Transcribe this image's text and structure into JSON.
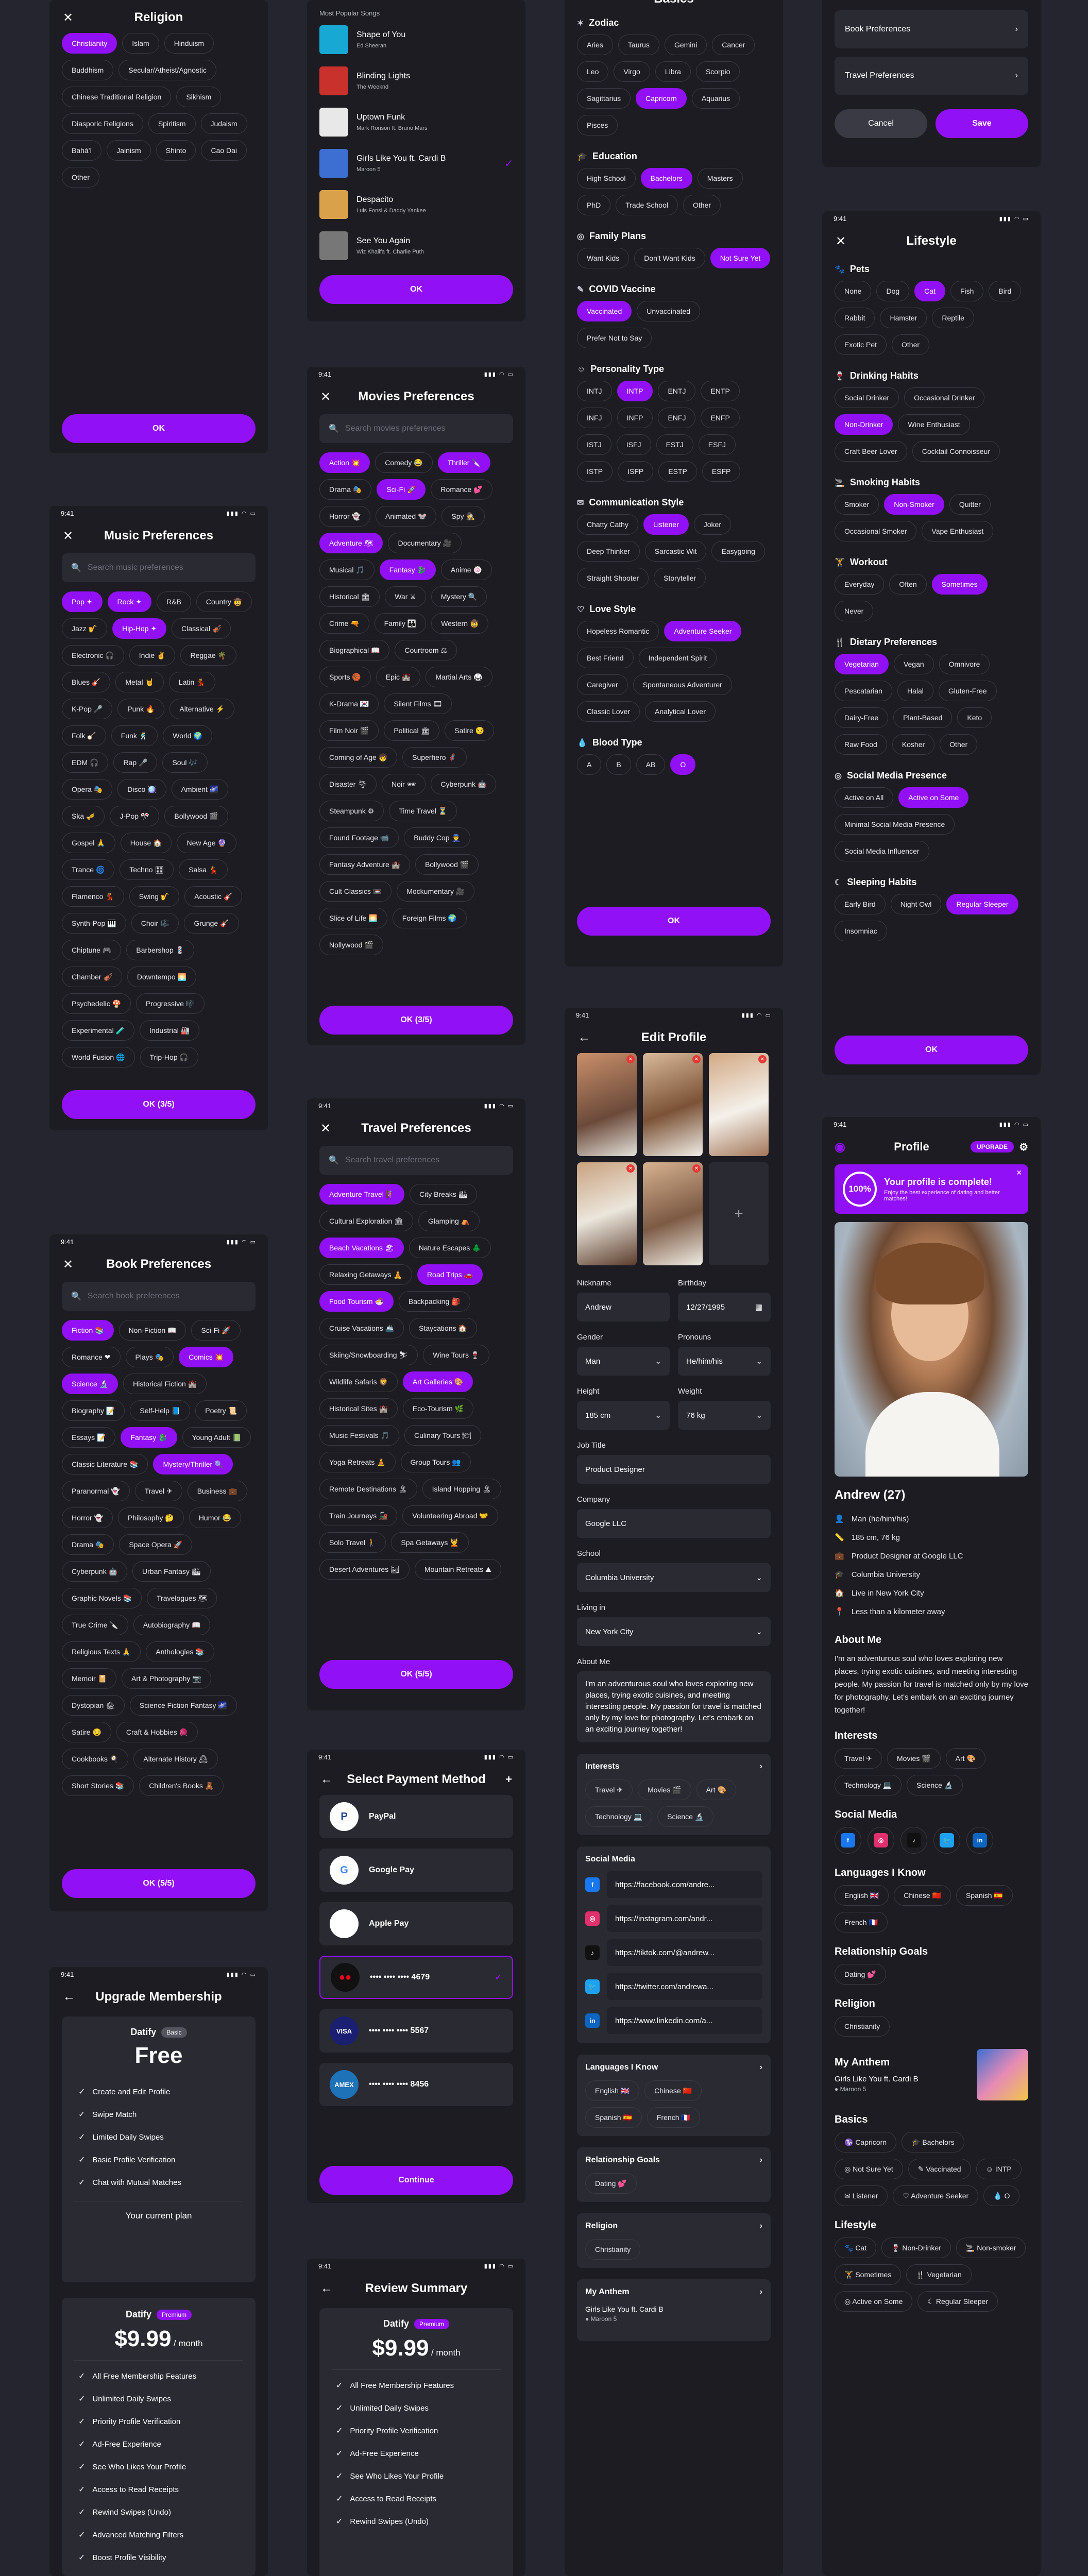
{
  "status_time": "9:41",
  "religion": {
    "title": "Religion",
    "close": "✕",
    "ok": "OK",
    "items": [
      "Christianity",
      "Islam",
      "Hinduism",
      "Buddhism",
      "Secular/Atheist/Agnostic",
      "Chinese Traditional Religion",
      "Sikhism",
      "Diasporic Religions",
      "Spiritism",
      "Judaism",
      "Bahá'í",
      "Jainism",
      "Shinto",
      "Cao Dai",
      "Other"
    ],
    "selected": [
      0
    ]
  },
  "music": {
    "title": "Music Preferences",
    "placeholder": "Search music preferences",
    "ok": "OK (3/5)",
    "items": [
      "Pop ✦",
      "Rock ✦",
      "R&B",
      "Country 🤠",
      "Jazz 🎷",
      "Hip-Hop ✦",
      "Classical 🎻",
      "Electronic 🎧",
      "Indie ✌",
      "Reggae 🌴",
      "Blues 🎸",
      "Metal 🤘",
      "Latin 💃",
      "K-Pop 🎤",
      "Punk 🔥",
      "Alternative ⚡",
      "Folk 🪕",
      "Funk 🕺",
      "World 🌍",
      "EDM 🎧",
      "Rap 🎤",
      "Soul 🎶",
      "Opera 🎭",
      "Disco 🪩",
      "Ambient 🌌",
      "Ska 🎺",
      "J-Pop 🎌",
      "Bollywood 🎬",
      "Gospel 🙏",
      "House 🏠",
      "New Age 🔮",
      "Trance 🌀",
      "Techno 🎛",
      "Salsa 💃",
      "Flamenco 💃",
      "Swing 🎷",
      "Acoustic 🎸",
      "Synth-Pop 🎹",
      "Choir 🎼",
      "Grunge 🎸",
      "Chiptune 🎮",
      "Barbershop 💈",
      "Chamber 🎻",
      "Downtempo 🌅",
      "Psychedelic 🍄",
      "Progressive 🎼",
      "Experimental 🧪",
      "Industrial 🏭",
      "World Fusion 🌐",
      "Trip-Hop 🎧"
    ],
    "selected": [
      0,
      1,
      5
    ]
  },
  "book": {
    "title": "Book Preferences",
    "placeholder": "Search book preferences",
    "ok": "OK (5/5)",
    "items": [
      "Fiction 📚",
      "Non-Fiction 📖",
      "Sci-Fi 🚀",
      "Romance ❤",
      "Plays 🎭",
      "Comics 💥",
      "Science 🔬",
      "Historical Fiction 🏰",
      "Biography 📝",
      "Self-Help 📘",
      "Poetry 📜",
      "Essays 📝",
      "Fantasy 🐉",
      "Young Adult 📗",
      "Classic Literature 📚",
      "Mystery/Thriller 🔍",
      "Paranormal 👻",
      "Travel ✈",
      "Business 💼",
      "Horror 👻",
      "Philosophy 🤔",
      "Humor 😂",
      "Drama 🎭",
      "Space Opera 🚀",
      "Cyberpunk 🤖",
      "Urban Fantasy 🏙",
      "Graphic Novels 📚",
      "Travelogues 🗺",
      "True Crime 🔪",
      "Autobiography 📖",
      "Religious Texts 🙏",
      "Anthologies 📚",
      "Memoir 📔",
      "Art & Photography 📷",
      "Dystopian 🏚",
      "Science Fiction Fantasy 🌌",
      "Satire 😏",
      "Craft & Hobbies 🧶",
      "Cookbooks 🍳",
      "Alternate History 🕰",
      "Short Stories 📚",
      "Children's Books 🧸"
    ],
    "selected": [
      0,
      5,
      6,
      12,
      15
    ]
  },
  "upgrade": {
    "title": "Upgrade Membership",
    "plan": "Datify",
    "basic": "Basic",
    "free": "Free",
    "free_feats": [
      "Create and Edit Profile",
      "Swipe Match",
      "Limited Daily Swipes",
      "Basic Profile Verification",
      "Chat with Mutual Matches"
    ],
    "current": "Your current plan",
    "premium": "Premium",
    "price": "$9.99",
    "per": "/ month",
    "prem_feats": [
      "All Free Membership Features",
      "Unlimited Daily Swipes",
      "Priority Profile Verification",
      "Ad-Free Experience",
      "See Who Likes Your Profile",
      "Access to Read Receipts",
      "Rewind Swipes (Undo)",
      "Advanced Matching Filters",
      "Boost Profile Visibility"
    ]
  },
  "songs": {
    "label": "Most Popular Songs",
    "ok": "OK",
    "items": [
      {
        "t": "Shape of You",
        "a": "Ed Sheeran",
        "c": "#17a8d4"
      },
      {
        "t": "Blinding Lights",
        "a": "The Weeknd",
        "c": "#c8312c"
      },
      {
        "t": "Uptown Funk",
        "a": "Mark Ronson ft. Bruno Mars",
        "c": "#e8e8e8"
      },
      {
        "t": "Girls Like You ft. Cardi B",
        "a": "Maroon 5",
        "c": "#3c6fd1"
      },
      {
        "t": "Despacito",
        "a": "Luis Fonsi & Daddy Yankee",
        "c": "#d9a24a"
      },
      {
        "t": "See You Again",
        "a": "Wiz Khalifa ft. Charlie Puth",
        "c": "#777"
      }
    ]
  },
  "movies": {
    "title": "Movies Preferences",
    "placeholder": "Search movies preferences",
    "ok": "OK (3/5)",
    "items": [
      "Action 💥",
      "Comedy 😂",
      "Thriller 🔪",
      "Drama 🎭",
      "Sci-Fi 🚀",
      "Romance 💕",
      "Horror 👻",
      "Animated 🐭",
      "Spy 🕵",
      "Adventure 🗺",
      "Documentary 🎥",
      "Musical 🎵",
      "Fantasy 🐉",
      "Anime 🍥",
      "Historical 🏛",
      "War ⚔",
      "Mystery 🔍",
      "Crime 🔫",
      "Family 👪",
      "Western 🤠",
      "Biographical 📖",
      "Courtroom ⚖",
      "Sports 🏀",
      "Epic 🏰",
      "Martial Arts 🥋",
      "K-Drama 🇰🇷",
      "Silent Films 🎞",
      "Film Noir 🎬",
      "Political 🏛",
      "Satire 😏",
      "Coming of Age 🧒",
      "Superhero 🦸",
      "Disaster 🌪",
      "Noir 🕶",
      "Cyberpunk 🤖",
      "Steampunk ⚙",
      "Time Travel ⏳",
      "Found Footage 📹",
      "Buddy Cop 👮",
      "Fantasy Adventure 🏰",
      "Bollywood 🎬",
      "Cult Classics 📼",
      "Mockumentary 🎥",
      "Slice of Life 🌅",
      "Foreign Films 🌍",
      "Nollywood 🎬"
    ],
    "selected": [
      0,
      2,
      4,
      9,
      12
    ]
  },
  "travel": {
    "title": "Travel Preferences",
    "placeholder": "Search travel preferences",
    "ok": "OK (5/5)",
    "items": [
      "Adventure Travel 🧗",
      "City Breaks 🏙",
      "Cultural Exploration 🏛",
      "Glamping ⛺",
      "Beach Vacations 🏖",
      "Nature Escapes 🌲",
      "Relaxing Getaways 🧘",
      "Road Trips 🚗",
      "Food Tourism 🍜",
      "Backpacking 🎒",
      "Cruise Vacations 🚢",
      "Staycations 🏠",
      "Skiing/Snowboarding ⛷",
      "Wine Tours 🍷",
      "Wildlife Safaris 🦁",
      "Art Galleries 🎨",
      "Historical Sites 🏰",
      "Eco-Tourism 🌿",
      "Music Festivals 🎵",
      "Culinary Tours 🍽",
      "Yoga Retreats 🧘",
      "Group Tours 👥",
      "Remote Destinations 🏝",
      "Island Hopping 🏝",
      "Train Journeys 🚂",
      "Volunteering Abroad 🤝",
      "Solo Travel 🚶",
      "Spa Getaways 💆",
      "Desert Adventures 🏜",
      "Mountain Retreats ⛰"
    ],
    "selected": [
      0,
      4,
      7,
      8,
      15
    ]
  },
  "payment": {
    "title": "Select Payment Method",
    "continue": "Continue",
    "methods": [
      {
        "n": "PayPal",
        "c": "#ffffff",
        "g": "P",
        "gc": "#1b3e92"
      },
      {
        "n": "Google Pay",
        "c": "#ffffff",
        "g": "G",
        "gc": "#4285f4"
      },
      {
        "n": "Apple Pay",
        "c": "#ffffff",
        "g": "",
        "gc": "#000"
      },
      {
        "n": "•••• •••• •••• 4679",
        "c": "#111",
        "g": "●●",
        "gc": "#eb001b"
      },
      {
        "n": "•••• •••• •••• 5567",
        "c": "#1a1f71",
        "g": "VISA",
        "gc": "#fff"
      },
      {
        "n": "•••• •••• •••• 8456",
        "c": "#1d72b8",
        "g": "AMEX",
        "gc": "#fff"
      }
    ]
  },
  "review": {
    "title": "Review Summary",
    "plan": "Datify",
    "premium": "Premium",
    "price": "$9.99",
    "per": "/ month",
    "feats": [
      "All Free Membership Features",
      "Unlimited Daily Swipes",
      "Priority Profile Verification",
      "Ad-Free Experience",
      "See Who Likes Your Profile",
      "Access to Read Receipts",
      "Rewind Swipes (Undo)"
    ]
  },
  "basics": {
    "title": "Basics",
    "ok": "OK",
    "groups": [
      {
        "t": "Zodiac",
        "i": "✶",
        "items": [
          "Aries",
          "Taurus",
          "Gemini",
          "Cancer",
          "Leo",
          "Virgo",
          "Libra",
          "Scorpio",
          "Sagittarius",
          "Capricorn",
          "Aquarius",
          "Pisces"
        ],
        "sel": [
          9
        ]
      },
      {
        "t": "Education",
        "i": "🎓",
        "items": [
          "High School",
          "Bachelors",
          "Masters",
          "PhD",
          "Trade School",
          "Other"
        ],
        "sel": [
          1
        ]
      },
      {
        "t": "Family Plans",
        "i": "◎",
        "items": [
          "Want Kids",
          "Don't Want Kids",
          "Not Sure Yet"
        ],
        "sel": [
          2
        ]
      },
      {
        "t": "COVID Vaccine",
        "i": "✎",
        "items": [
          "Vaccinated",
          "Unvaccinated",
          "Prefer Not to Say"
        ],
        "sel": [
          0
        ]
      },
      {
        "t": "Personality Type",
        "i": "☺",
        "items": [
          "INTJ",
          "INTP",
          "ENTJ",
          "ENTP",
          "INFJ",
          "INFP",
          "ENFJ",
          "ENFP",
          "ISTJ",
          "ISFJ",
          "ESTJ",
          "ESFJ",
          "ISTP",
          "ISFP",
          "ESTP",
          "ESFP"
        ],
        "sel": [
          1
        ]
      },
      {
        "t": "Communication Style",
        "i": "✉",
        "items": [
          "Chatty Cathy",
          "Listener",
          "Joker",
          "Deep Thinker",
          "Sarcastic Wit",
          "Easygoing",
          "Straight Shooter",
          "Storyteller"
        ],
        "sel": [
          1
        ]
      },
      {
        "t": "Love Style",
        "i": "♡",
        "items": [
          "Hopeless Romantic",
          "Adventure Seeker",
          "Best Friend",
          "Independent Spirit",
          "Caregiver",
          "Spontaneous Adventurer",
          "Classic Lover",
          "Analytical Lover"
        ],
        "sel": [
          1
        ]
      },
      {
        "t": "Blood Type",
        "i": "💧",
        "items": [
          "A",
          "B",
          "AB",
          "O"
        ],
        "sel": [
          3
        ]
      }
    ]
  },
  "editprofile": {
    "title": "Edit Profile",
    "nickname_l": "Nickname",
    "nickname": "Andrew",
    "birthday_l": "Birthday",
    "birthday": "12/27/1995",
    "gender_l": "Gender",
    "gender": "Man",
    "pronouns_l": "Pronouns",
    "pronouns": "He/him/his",
    "height_l": "Height",
    "height": "185 cm",
    "weight_l": "Weight",
    "weight": "76 kg",
    "job_l": "Job Title",
    "job": "Product Designer",
    "company_l": "Company",
    "company": "Google LLC",
    "school_l": "School",
    "school": "Columbia University",
    "living_l": "Living in",
    "living": "New York City",
    "about_l": "About Me",
    "about": "I'm an adventurous soul who loves exploring new places, trying exotic cuisines, and meeting interesting people. My passion for travel is matched only by my love for photography. Let's embark on an exciting journey together!",
    "interests_l": "Interests",
    "interests": [
      "Travel ✈",
      "Movies 🎬",
      "Art 🎨",
      "Technology 💻",
      "Science 🔬"
    ],
    "social_l": "Social Media",
    "social": [
      {
        "u": "https://facebook.com/andre...",
        "c": "#1877f2",
        "g": "f"
      },
      {
        "u": "https://instagram.com/andr...",
        "c": "#e1306c",
        "g": "◎"
      },
      {
        "u": "https://tiktok.com/@andrew...",
        "c": "#111",
        "g": "♪"
      },
      {
        "u": "https://twitter.com/andrewa...",
        "c": "#1da1f2",
        "g": "🐦"
      },
      {
        "u": "https://www.linkedin.com/a...",
        "c": "#0a66c2",
        "g": "in"
      }
    ],
    "lang_l": "Languages I Know",
    "langs": [
      "English 🇬🇧",
      "Chinese 🇨🇳",
      "Spanish 🇪🇸",
      "French 🇫🇷"
    ],
    "goals_l": "Relationship Goals",
    "goal": "Dating 💕",
    "religion_l": "Religion",
    "religion": "Christianity",
    "anthem_l": "My Anthem",
    "anthem": "Girls Like You ft. Cardi B",
    "artist": "Maroon 5"
  },
  "pref_top": {
    "items": [
      "Book Preferences",
      "Travel Preferences"
    ],
    "cancel": "Cancel",
    "save": "Save"
  },
  "lifestyle": {
    "title": "Lifestyle",
    "ok": "OK",
    "groups": [
      {
        "t": "Pets",
        "i": "🐾",
        "items": [
          "None",
          "Dog",
          "Cat",
          "Fish",
          "Bird",
          "Rabbit",
          "Hamster",
          "Reptile",
          "Exotic Pet",
          "Other"
        ],
        "sel": [
          2
        ]
      },
      {
        "t": "Drinking Habits",
        "i": "🍷",
        "items": [
          "Social Drinker",
          "Occasional Drinker",
          "Non-Drinker",
          "Wine Enthusiast",
          "Craft Beer Lover",
          "Cocktail Connoisseur"
        ],
        "sel": [
          2
        ]
      },
      {
        "t": "Smoking Habits",
        "i": "🚬",
        "items": [
          "Smoker",
          "Non-Smoker",
          "Quitter",
          "Occasional Smoker",
          "Vape Enthusiast"
        ],
        "sel": [
          1
        ]
      },
      {
        "t": "Workout",
        "i": "🏋",
        "items": [
          "Everyday",
          "Often",
          "Sometimes",
          "Never"
        ],
        "sel": [
          2
        ]
      },
      {
        "t": "Dietary Preferences",
        "i": "🍴",
        "items": [
          "Vegetarian",
          "Vegan",
          "Omnivore",
          "Pescatarian",
          "Halal",
          "Gluten-Free",
          "Dairy-Free",
          "Plant-Based",
          "Keto",
          "Raw Food",
          "Kosher",
          "Other"
        ],
        "sel": [
          0
        ]
      },
      {
        "t": "Social Media Presence",
        "i": "◎",
        "items": [
          "Active on All",
          "Active on Some",
          "Minimal Social Media Presence",
          "Social Media Influencer"
        ],
        "sel": [
          1
        ]
      },
      {
        "t": "Sleeping Habits",
        "i": "☾",
        "items": [
          "Early Bird",
          "Night Owl",
          "Regular Sleeper",
          "Insomniac"
        ],
        "sel": [
          2
        ]
      }
    ]
  },
  "profile": {
    "title": "Profile",
    "upgrade": "UPGRADE",
    "complete_pct": "100%",
    "complete_t": "Your profile is complete!",
    "complete_s": "Enjoy the best experience of dating and better matches!",
    "name": "Andrew (27)",
    "facts": [
      {
        "i": "👤",
        "t": "Man (he/him/his)"
      },
      {
        "i": "📏",
        "t": "185 cm, 76 kg"
      },
      {
        "i": "💼",
        "t": "Product Designer at Google LLC"
      },
      {
        "i": "🎓",
        "t": "Columbia University"
      },
      {
        "i": "🏠",
        "t": "Live in New York City"
      },
      {
        "i": "📍",
        "t": "Less than a kilometer away"
      }
    ],
    "about_l": "About Me",
    "about": "I'm an adventurous soul who loves exploring new places, trying exotic cuisines, and meeting interesting people. My passion for travel is matched only by my love for photography. Let's embark on an exciting journey together!",
    "interests_l": "Interests",
    "interests": [
      "Travel ✈",
      "Movies 🎬",
      "Art 🎨",
      "Technology 💻",
      "Science 🔬"
    ],
    "social_l": "Social Media",
    "lang_l": "Languages I Know",
    "langs": [
      "English 🇬🇧",
      "Chinese 🇨🇳",
      "Spanish 🇪🇸",
      "French 🇫🇷"
    ],
    "goals_l": "Relationship Goals",
    "goal": "Dating 💕",
    "religion_l": "Religion",
    "religion": "Christianity",
    "anthem_l": "My Anthem",
    "anthem": "Girls Like You ft. Cardi B",
    "artist": "Maroon 5",
    "basics_l": "Basics",
    "basics": [
      "♑ Capricorn",
      "🎓 Bachelors",
      "◎ Not Sure Yet",
      "✎ Vaccinated",
      "☺ INTP",
      "✉ Listener",
      "♡ Adventure Seeker",
      "💧 O"
    ],
    "life_l": "Lifestyle",
    "life": [
      "🐾 Cat",
      "🍷 Non-Drinker",
      "🚬 Non-smoker",
      "🏋 Sometimes",
      "🍴 Vegetarian",
      "◎ Active on Some",
      "☾ Regular Sleeper"
    ]
  }
}
